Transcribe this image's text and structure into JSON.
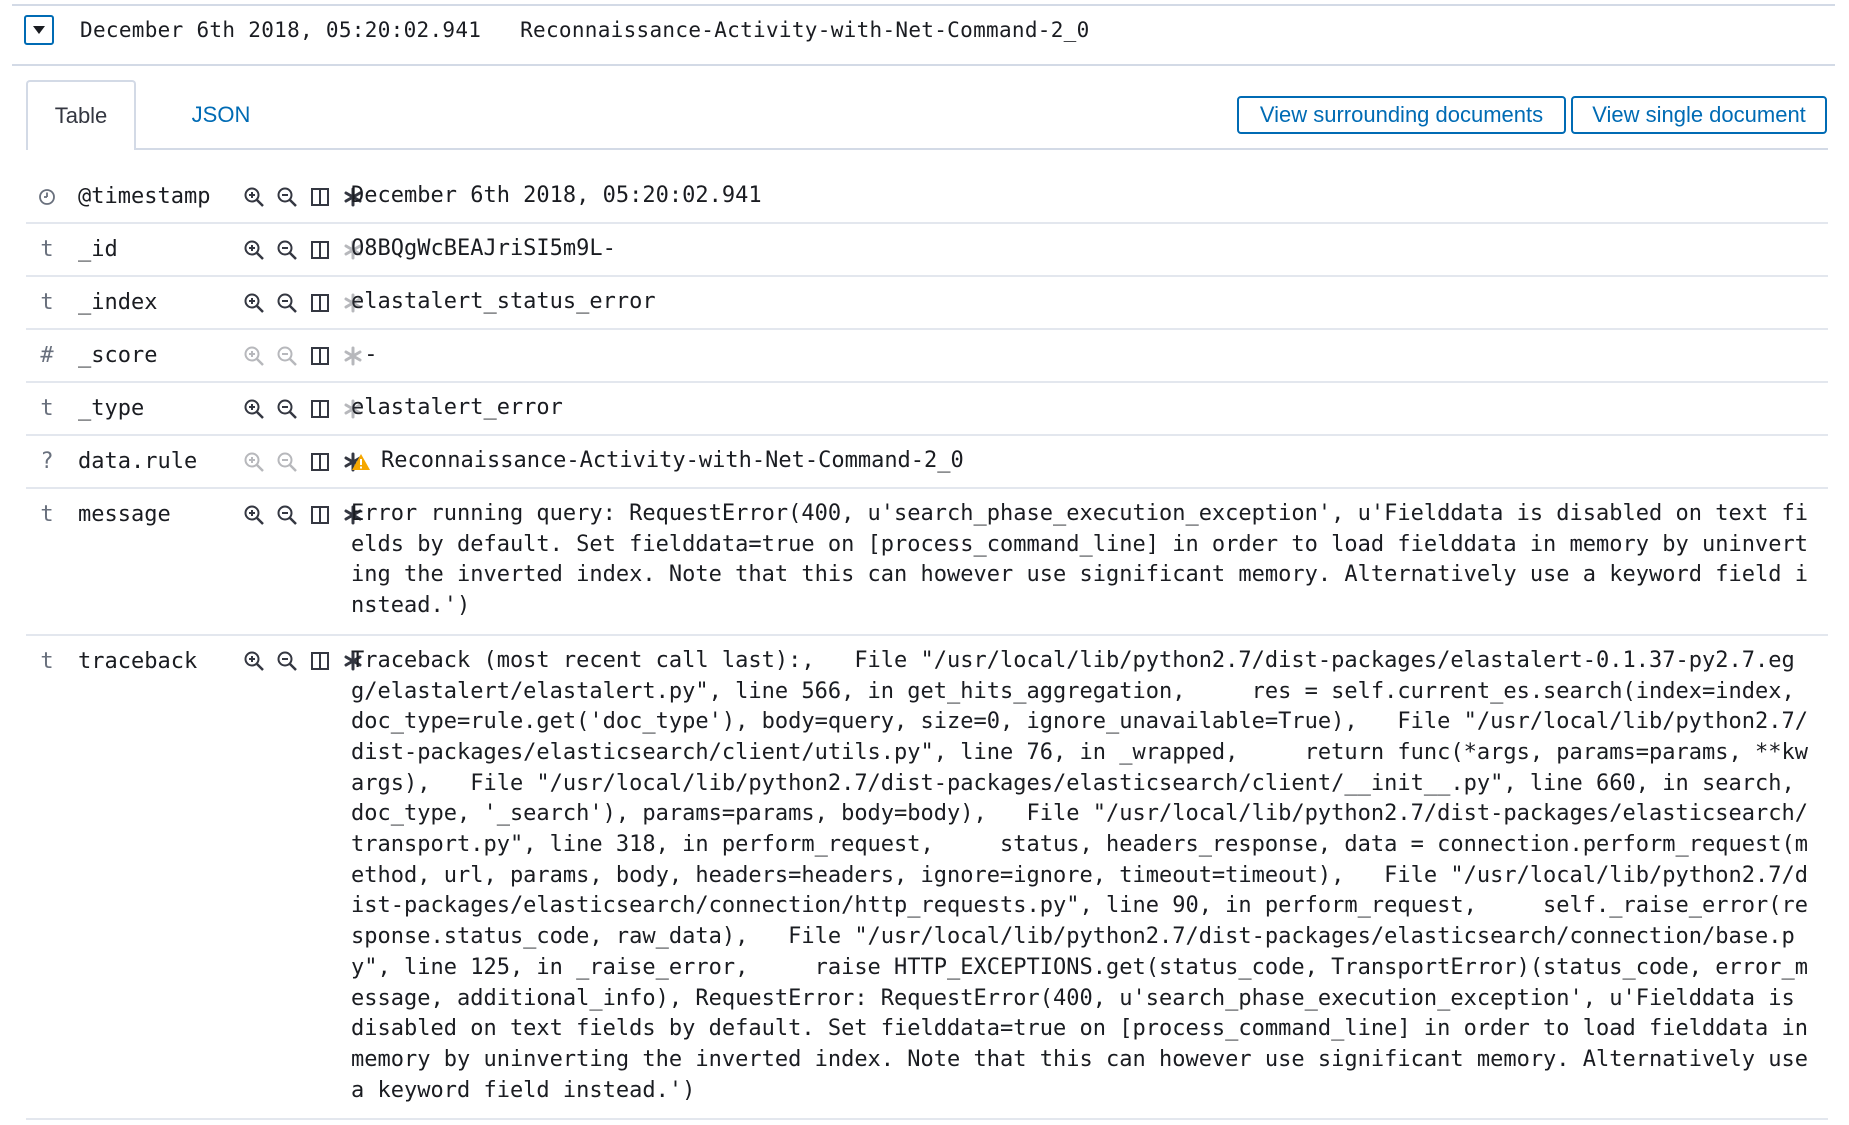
{
  "doc": {
    "title": "December 6th 2018, 05:20:02.941   Reconnaissance-Activity-with-Net-Command-2_0"
  },
  "tabs": [
    {
      "label": "Table",
      "active": true
    },
    {
      "label": "JSON",
      "active": false
    }
  ],
  "buttons": {
    "surrounding": "View surrounding documents",
    "single": "View single document"
  },
  "colors": {
    "accent": "#006bb4",
    "warning": "#f5a700",
    "border": "#d3dae6"
  },
  "fields": [
    {
      "type": "clock-icon",
      "name": "@timestamp",
      "value": "December 6th 2018, 05:20:02.941",
      "filter_enabled": true,
      "exists_enabled": true
    },
    {
      "type": "t",
      "name": "_id",
      "value": "O8BQgWcBEAJriSI5m9L-",
      "filter_enabled": true,
      "exists_enabled": false
    },
    {
      "type": "t",
      "name": "_index",
      "value": "elastalert_status_error",
      "filter_enabled": true,
      "exists_enabled": false
    },
    {
      "type": "#",
      "name": "_score",
      "value": " -",
      "filter_enabled": false,
      "exists_enabled": false
    },
    {
      "type": "t",
      "name": "_type",
      "value": "elastalert_error",
      "filter_enabled": true,
      "exists_enabled": false
    },
    {
      "type": "?",
      "name": "data.rule",
      "value": "Reconnaissance-Activity-with-Net-Command-2_0",
      "warning": true,
      "filter_enabled": false,
      "exists_enabled": true
    },
    {
      "type": "t",
      "name": "message",
      "value": "Error running query: RequestError(400, u'search_phase_execution_exception', u'Fielddata is disabled on text fields by default. Set fielddata=true on [process_command_line] in order to load fielddata in memory by uninverting the inverted index. Note that this can however use significant memory. Alternatively use a keyword field instead.')",
      "filter_enabled": true,
      "exists_enabled": true
    },
    {
      "type": "t",
      "name": "traceback",
      "value": "Traceback (most recent call last):,   File \"/usr/local/lib/python2.7/dist-packages/elastalert-0.1.37-py2.7.egg/elastalert/elastalert.py\", line 566, in get_hits_aggregation,     res = self.current_es.search(index=index, doc_type=rule.get('doc_type'), body=query, size=0, ignore_unavailable=True),   File \"/usr/local/lib/python2.7/dist-packages/elasticsearch/client/utils.py\", line 76, in _wrapped,     return func(*args, params=params, **kwargs),   File \"/usr/local/lib/python2.7/dist-packages/elasticsearch/client/__init__.py\", line 660, in search,     doc_type, '_search'), params=params, body=body),   File \"/usr/local/lib/python2.7/dist-packages/elasticsearch/transport.py\", line 318, in perform_request,     status, headers_response, data = connection.perform_request(method, url, params, body, headers=headers, ignore=ignore, timeout=timeout),   File \"/usr/local/lib/python2.7/dist-packages/elasticsearch/connection/http_requests.py\", line 90, in perform_request,     self._raise_error(response.status_code, raw_data),   File \"/usr/local/lib/python2.7/dist-packages/elasticsearch/connection/base.py\", line 125, in _raise_error,     raise HTTP_EXCEPTIONS.get(status_code, TransportError)(status_code, error_message, additional_info), RequestError: RequestError(400, u'search_phase_execution_exception', u'Fielddata is disabled on text fields by default. Set fielddata=true on [process_command_line] in order to load fielddata in memory by uninverting the inverted index. Note that this can however use significant memory. Alternatively use a keyword field instead.')",
      "filter_enabled": true,
      "exists_enabled": true
    }
  ]
}
